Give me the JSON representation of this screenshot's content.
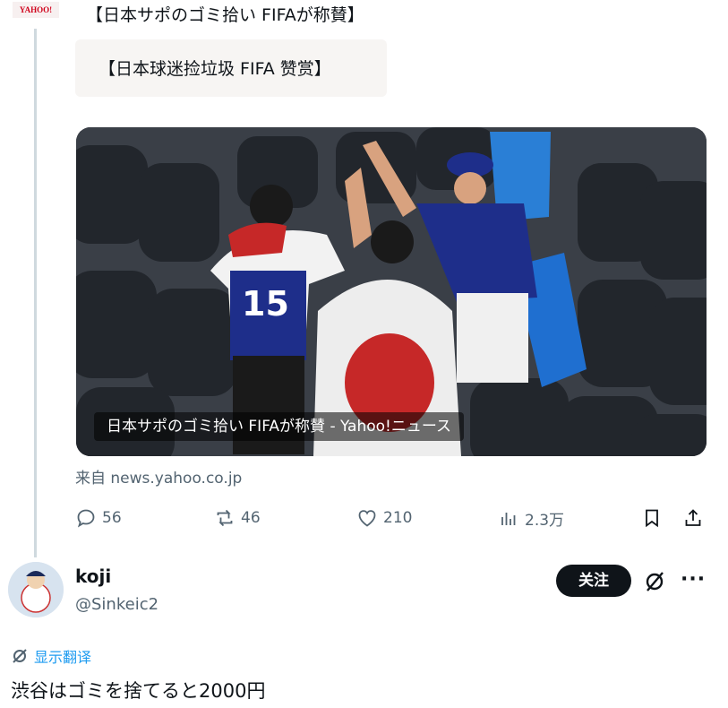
{
  "source_logo": "YAHOO!",
  "tweet": {
    "text": "【日本サポのゴミ拾い FIFAが称賛】",
    "quote": "【日本球迷捡垃圾 FIFA 赞赏】",
    "media_caption": "日本サポのゴミ拾い FIFAが称賛 - Yahoo!ニュース",
    "link_source": "来自 news.yahoo.co.jp",
    "replies": "56",
    "retweets": "46",
    "likes": "210",
    "views": "2.3万"
  },
  "reply": {
    "name": "koji",
    "handle": "@Sinkeic2",
    "follow_label": "关注",
    "more_label": "···",
    "translate_label": "显示翻译",
    "text": "渋谷はゴミを捨てると2000円"
  },
  "colors": {
    "text": "#0f1419",
    "secondary": "#536471",
    "link_blue": "#1d9bf0",
    "follow_bg": "#0f1419"
  }
}
